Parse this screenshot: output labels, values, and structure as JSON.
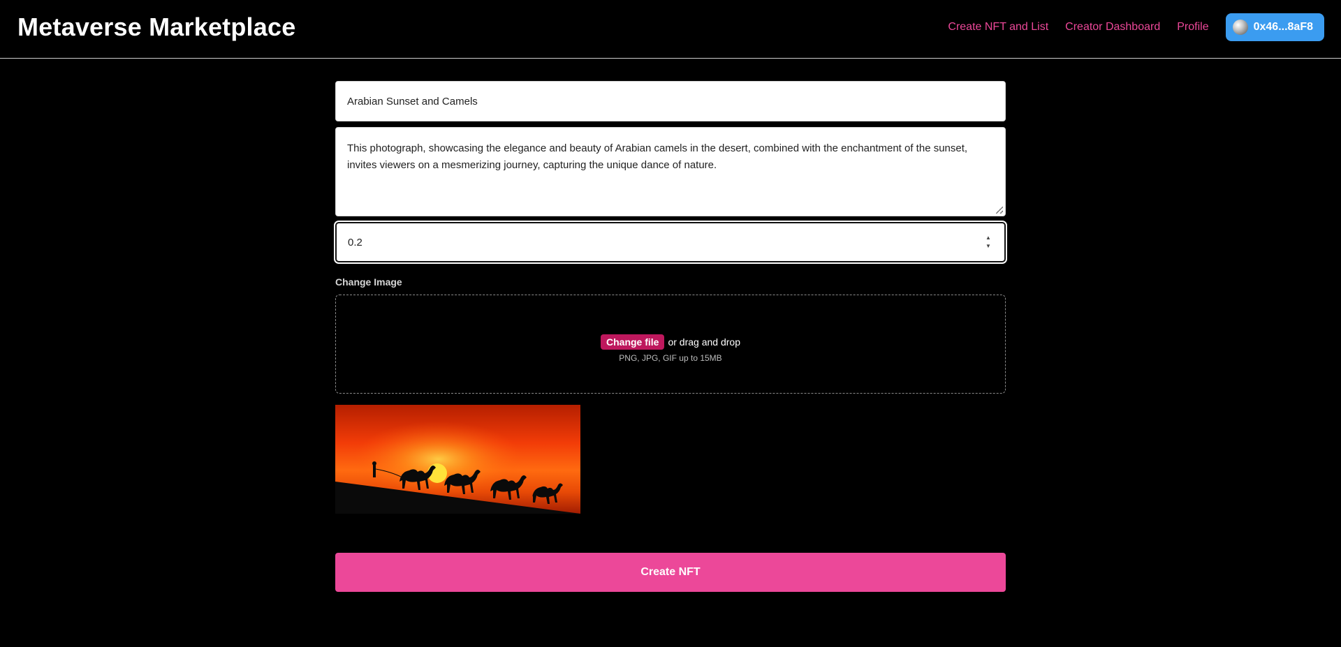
{
  "header": {
    "brand": "Metaverse Marketplace",
    "nav": [
      {
        "label": "Create NFT and List"
      },
      {
        "label": "Creator Dashboard"
      },
      {
        "label": "Profile"
      }
    ],
    "wallet": "0x46...8aF8"
  },
  "form": {
    "name_value": "Arabian Sunset and Camels",
    "description_value": "This photograph, showcasing the elegance and beauty of Arabian camels in the desert, combined with the enchantment of the sunset, invites viewers on a mesmerizing journey, capturing the unique dance of nature.",
    "price_value": "0.2",
    "image_label": "Change Image",
    "change_file_label": "Change file",
    "drag_drop_text": "or drag and drop",
    "file_hint": "PNG, JPG, GIF up to 15MB",
    "submit_label": "Create NFT"
  },
  "colors": {
    "accent": "#ec4899",
    "wallet_button": "#3b9cf0",
    "change_file_button": "#be185d"
  },
  "icons": {
    "wallet": "wallet-avatar-icon",
    "stepper": "number-stepper-icon",
    "resize": "resize-handle-icon"
  }
}
